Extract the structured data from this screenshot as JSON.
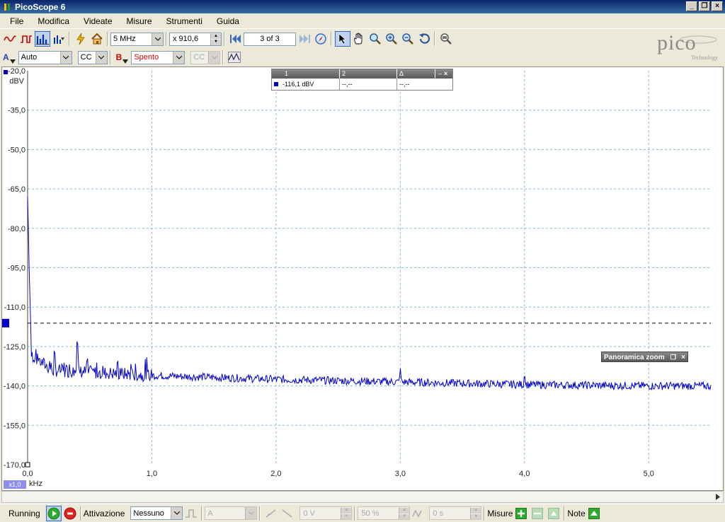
{
  "window": {
    "title": "PicoScope 6",
    "buttons": [
      "_",
      "❐",
      "×"
    ]
  },
  "menu": [
    "File",
    "Modifica",
    "Videate",
    "Misure",
    "Strumenti",
    "Guida"
  ],
  "toolbar": {
    "samples_label": "5 MHz",
    "zoom_label": "x 910,6",
    "buffer_label": "3 of 3"
  },
  "channels": {
    "a_label": "A",
    "a_range": "Auto",
    "a_coupling": "CC",
    "b_label": "B",
    "b_range": "Spento",
    "b_coupling": "CC"
  },
  "logo": {
    "word": "pico",
    "tag": "Technology"
  },
  "measure_table": {
    "headers": [
      "1",
      "2",
      "Δ"
    ],
    "values": [
      "-116,1 dBV",
      "--,--",
      "--,--"
    ]
  },
  "zoom_overview": {
    "title": "Panoramica zoom"
  },
  "axis": {
    "y_unit": "dBV",
    "x_unit": "kHz",
    "x_scale": "x1,0"
  },
  "status": {
    "running": "Running",
    "trigger_label": "Attivazione",
    "trigger_mode": "Nessuno",
    "trigger_channel": "A",
    "trigger_level": "0 V",
    "pretrigger": "50 %",
    "delay": "0 s",
    "measurements_label": "Misure",
    "notes_label": "Note"
  },
  "colors": {
    "trace": "#0000cc",
    "grid": "#80c0d0",
    "accent": "#316ac5"
  },
  "chart_data": {
    "type": "line",
    "xlabel": "kHz",
    "ylabel": "dBV",
    "xlim": [
      0,
      5.5
    ],
    "ylim": [
      -170,
      -20
    ],
    "x_ticks": [
      "0,0",
      "1,0",
      "2,0",
      "3,0",
      "4,0",
      "5,0"
    ],
    "x_tick_values": [
      0,
      1,
      2,
      3,
      4,
      5
    ],
    "y_ticks": [
      "-20,0",
      "-35,0",
      "-50,0",
      "-65,0",
      "-80,0",
      "-95,0",
      "-110,0",
      "-125,0",
      "-140,0",
      "-155,0",
      "-170,0"
    ],
    "y_tick_values": [
      -20,
      -35,
      -50,
      -65,
      -80,
      -95,
      -110,
      -125,
      -140,
      -155,
      -170
    ],
    "ruler_y": -116.1,
    "peaks": [
      {
        "x": 0.0,
        "y": -68
      },
      {
        "x": 0.4,
        "y": -118
      },
      {
        "x": 3.0,
        "y": -133
      },
      {
        "x": 4.0,
        "y": -135
      }
    ],
    "noise_floor": [
      {
        "x": 0.02,
        "y": -128
      },
      {
        "x": 0.2,
        "y": -134
      },
      {
        "x": 0.6,
        "y": -135
      },
      {
        "x": 1.0,
        "y": -136
      },
      {
        "x": 2.0,
        "y": -137.5
      },
      {
        "x": 3.0,
        "y": -138.5
      },
      {
        "x": 4.0,
        "y": -139.5
      },
      {
        "x": 5.0,
        "y": -140
      },
      {
        "x": 5.5,
        "y": -140
      }
    ],
    "grid": true
  }
}
